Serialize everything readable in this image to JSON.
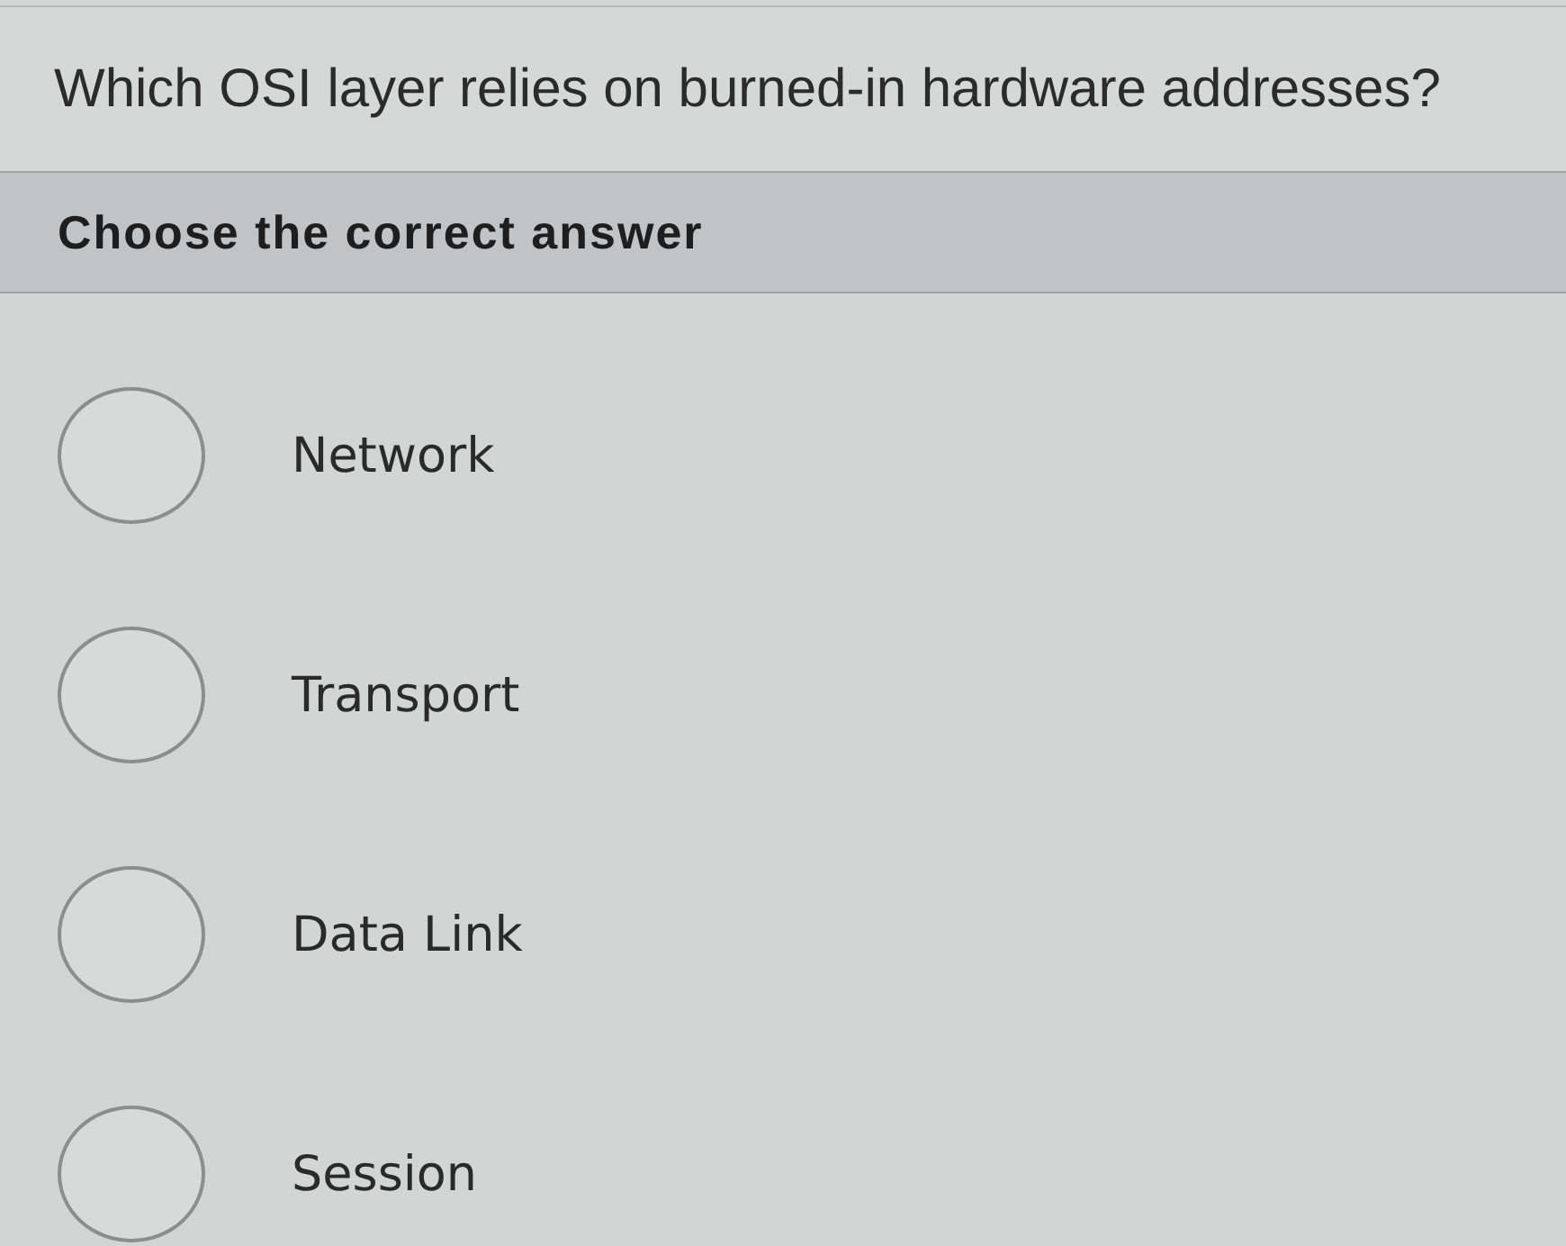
{
  "question": "Which OSI layer relies on burned-in hardware addresses?",
  "instruction": "Choose the correct answer",
  "options": [
    {
      "label": "Network",
      "selected": false
    },
    {
      "label": "Transport",
      "selected": false
    },
    {
      "label": "Data Link",
      "selected": false
    },
    {
      "label": "Session",
      "selected": false
    }
  ]
}
